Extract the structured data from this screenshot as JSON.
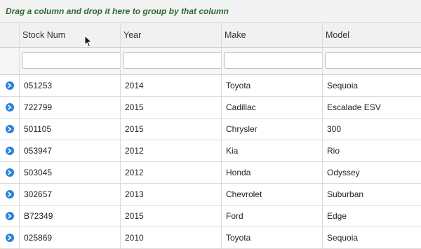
{
  "group_panel": {
    "text": "Drag a column and drop it here to group by that column"
  },
  "columns": [
    "Stock Num",
    "Year",
    "Make",
    "Model"
  ],
  "rows": [
    {
      "stock": "051253",
      "year": "2014",
      "make": "Toyota",
      "model": "Sequoia"
    },
    {
      "stock": "722799",
      "year": "2015",
      "make": "Cadillac",
      "model": "Escalade ESV"
    },
    {
      "stock": "501105",
      "year": "2015",
      "make": "Chrysler",
      "model": "300"
    },
    {
      "stock": "053947",
      "year": "2012",
      "make": "Kia",
      "model": "Rio"
    },
    {
      "stock": "503045",
      "year": "2012",
      "make": "Honda",
      "model": "Odyssey"
    },
    {
      "stock": "302657",
      "year": "2013",
      "make": "Chevrolet",
      "model": "Suburban"
    },
    {
      "stock": "B72349",
      "year": "2015",
      "make": "Ford",
      "model": "Edge"
    },
    {
      "stock": "025869",
      "year": "2010",
      "make": "Toyota",
      "model": "Sequoia"
    }
  ],
  "icons": {
    "expand": "expand-circle-arrow-icon",
    "filter_menu": "chevron-down-icon",
    "cursor": "mouse-pointer-icon"
  },
  "colors": {
    "group_text": "#2e6b2e",
    "expand_icon": "#2b82d9"
  }
}
